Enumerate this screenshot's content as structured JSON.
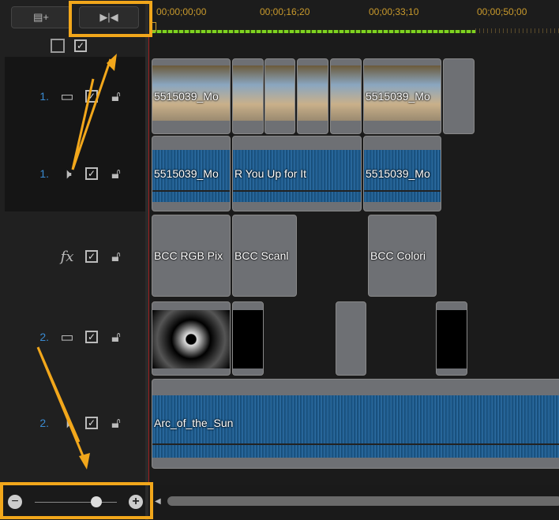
{
  "toolbar": {
    "buttons": [
      {
        "icon": "add-track-icon"
      },
      {
        "icon": "fit-timeline-icon"
      }
    ]
  },
  "ruler": {
    "timecodes": [
      "00;00;00;00",
      "00;00;16;20",
      "00;00;33;10",
      "00;00;50;00"
    ]
  },
  "tracks": {
    "video1": {
      "number": "1.",
      "icon": "video-track-icon",
      "enabled": true,
      "locked": false
    },
    "audio1": {
      "number": "1.",
      "icon": "speaker-icon",
      "enabled": true,
      "locked": false
    },
    "fx": {
      "label": "fx",
      "enabled": true,
      "locked": false
    },
    "video2": {
      "number": "2.",
      "icon": "video-track-icon",
      "enabled": true,
      "locked": false
    },
    "audio2": {
      "number": "2.",
      "icon": "speaker-icon",
      "enabled": true,
      "locked": false
    }
  },
  "clips": {
    "video1": [
      "5515039_Mo",
      "",
      "",
      "",
      "",
      "5515039_Mo",
      ""
    ],
    "audio1": [
      "5515039_Mo",
      "R You Up for It",
      "5515039_Mo"
    ],
    "fx": [
      "BCC RGB Pix",
      "BCC Scanl",
      "BCC Colori"
    ],
    "audio2": [
      "Arc_of_the_Sun"
    ]
  },
  "zoom": {
    "level_percent": 75
  },
  "colors": {
    "highlight": "#f2a71b",
    "accent": "#3a8ad0",
    "waveform": "#1e5a8c",
    "ruler_bar": "#7ed321"
  }
}
